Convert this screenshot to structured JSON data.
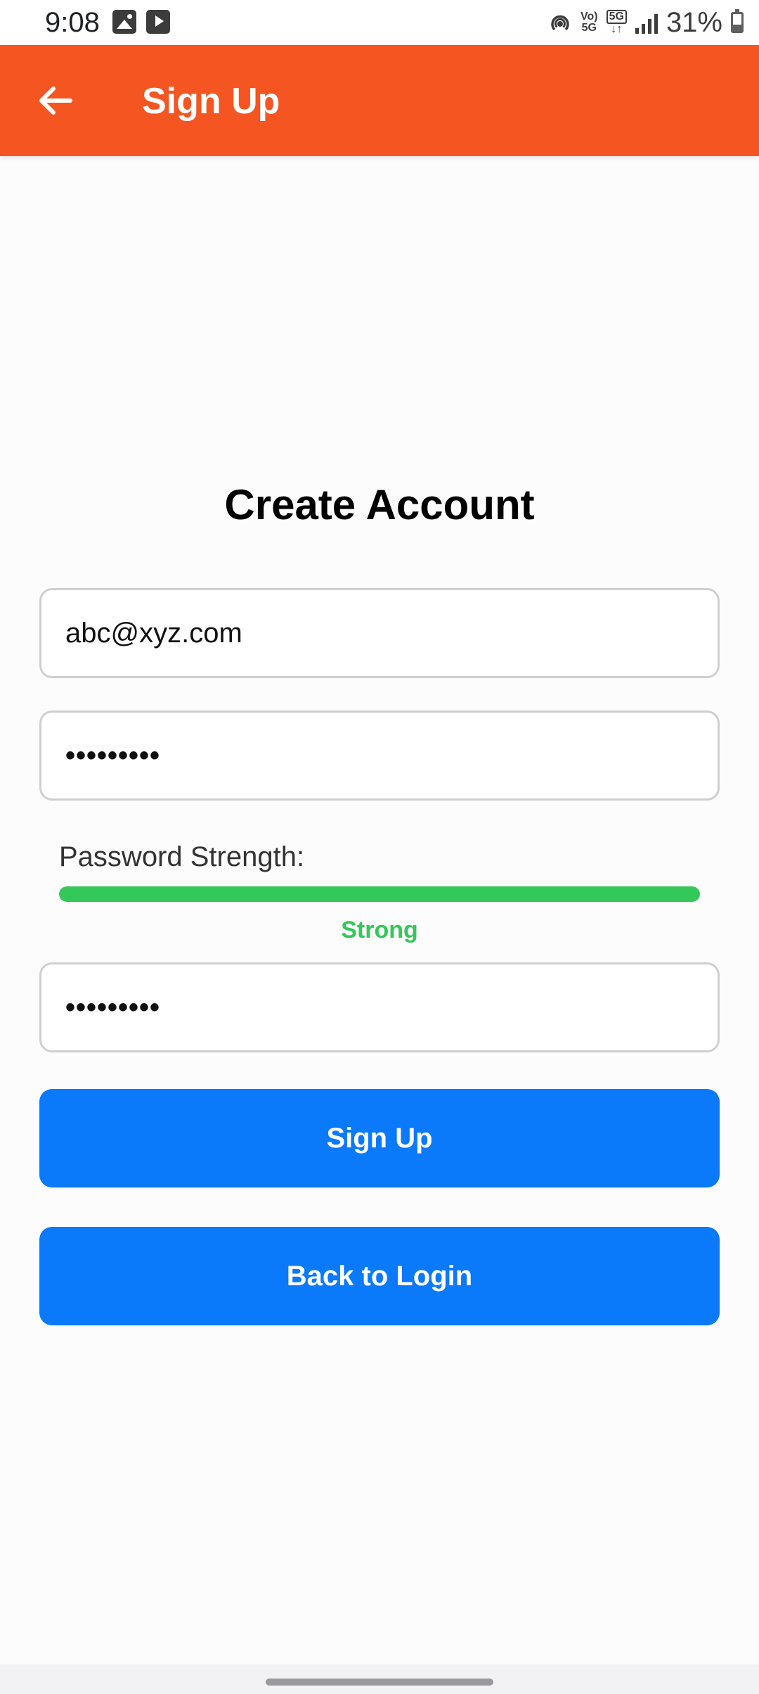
{
  "status_bar": {
    "time": "9:08",
    "network_top": "Vo)",
    "network_bottom": "5G",
    "data_top": "5G",
    "data_bottom": "↓↑",
    "battery_percent": "31%",
    "icons": [
      "image-icon",
      "video-icon",
      "hotspot-icon",
      "volte-icon",
      "5g-data-icon",
      "signal-icon",
      "battery-icon"
    ]
  },
  "app_bar": {
    "title": "Sign Up",
    "background": "#f55520"
  },
  "form": {
    "heading": "Create Account",
    "email_value": "abc@xyz.com",
    "password_value": "•••••••••",
    "confirm_password_value": "•••••••••",
    "strength_label": "Password Strength:",
    "strength_text": "Strong",
    "strength_level": 1.0,
    "strength_color": "#34c759"
  },
  "buttons": {
    "signup_label": "Sign Up",
    "back_to_login_label": "Back to Login",
    "color": "#0a7afa"
  }
}
